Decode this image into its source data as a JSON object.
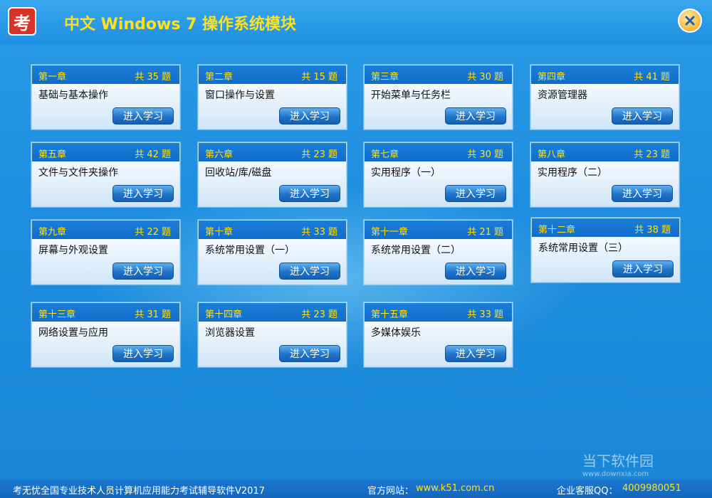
{
  "window": {
    "logo_text": "考",
    "title": "中文 Windows 7 操作系统模块",
    "close_label": "✕"
  },
  "chapters": [
    {
      "chapter": "第一章",
      "count": "共 35 题",
      "title": "基础与基本操作",
      "button": "进入学习"
    },
    {
      "chapter": "第二章",
      "count": "共 15 题",
      "title": "窗口操作与设置",
      "button": "进入学习"
    },
    {
      "chapter": "第三章",
      "count": "共 30 题",
      "title": "开始菜单与任务栏",
      "button": "进入学习"
    },
    {
      "chapter": "第四章",
      "count": "共 41 题",
      "title": "资源管理器",
      "button": "进入学习"
    },
    {
      "chapter": "第五章",
      "count": "共 42 题",
      "title": "文件与文件夹操作",
      "button": "进入学习"
    },
    {
      "chapter": "第六章",
      "count": "共 23 题",
      "title": "回收站/库/磁盘",
      "button": "进入学习"
    },
    {
      "chapter": "第七章",
      "count": "共 30 题",
      "title": "实用程序（一）",
      "button": "进入学习"
    },
    {
      "chapter": "第八章",
      "count": "共 23 题",
      "title": "实用程序（二）",
      "button": "进入学习"
    },
    {
      "chapter": "第九章",
      "count": "共 22 题",
      "title": "屏幕与外观设置",
      "button": "进入学习"
    },
    {
      "chapter": "第十章",
      "count": "共 33 题",
      "title": "系统常用设置（一）",
      "button": "进入学习"
    },
    {
      "chapter": "第十一章",
      "count": "共 21 题",
      "title": "系统常用设置（二）",
      "button": "进入学习"
    },
    {
      "chapter": "第十二章",
      "count": "共 38 题",
      "title": "系统常用设置（三）",
      "button": "进入学习"
    },
    {
      "chapter": "第十三章",
      "count": "共 31 题",
      "title": "网络设置与应用",
      "button": "进入学习"
    },
    {
      "chapter": "第十四章",
      "count": "共 23 题",
      "title": "浏览器设置",
      "button": "进入学习"
    },
    {
      "chapter": "第十五章",
      "count": "共 33 题",
      "title": "多媒体娱乐",
      "button": "进入学习"
    }
  ],
  "footer": {
    "product": "考无忧全国专业技术人员计算机应用能力考试辅导软件V2017",
    "site_label": "官方网站：",
    "site_url": "www.k51.com.cn",
    "qq_label": "企业客服QQ：",
    "qq_number": "4009980051"
  },
  "watermark": {
    "text": "当下软件园",
    "url": "www.downxia.com"
  }
}
